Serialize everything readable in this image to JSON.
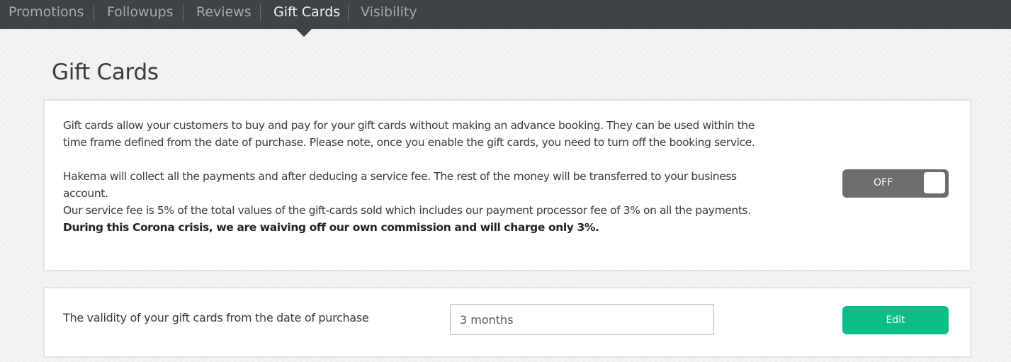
{
  "nav": {
    "tabs": [
      {
        "label": "Promotions",
        "active": false
      },
      {
        "label": "Followups",
        "active": false
      },
      {
        "label": "Reviews",
        "active": false
      },
      {
        "label": "Gift Cards",
        "active": true
      },
      {
        "label": "Visibility",
        "active": false
      }
    ]
  },
  "page": {
    "title": "Gift Cards"
  },
  "info_card": {
    "paragraph1": "Gift cards allow your customers to buy and pay for your gift cards without making an advance booking. They can be used within the time frame defined from the date of purchase. Please note, once you enable the gift cards, you need to turn off the booking service.",
    "paragraph2": "Hakema will collect all the payments and after deducing a service fee. The rest of the money will be transferred to your business account.",
    "paragraph3": "Our service fee is 5% of the total values of the gift-cards sold which includes our payment processor fee of 3% on all the payments.",
    "paragraph3_bold": "During this Corona crisis, we are waiving off our own commission and will charge only 3%.",
    "toggle": {
      "label": "OFF",
      "enabled": false
    }
  },
  "validity_card": {
    "label": "The validity of your gift cards from the date of purchase",
    "input_value": "3 months",
    "edit_label": "Edit"
  },
  "colors": {
    "nav_background": "#3f4347",
    "nav_active_text": "#f1f2f3",
    "nav_inactive_text": "#a7abaf",
    "toggle_off": "#6d6d6d",
    "edit_button": "#0dbd88"
  }
}
